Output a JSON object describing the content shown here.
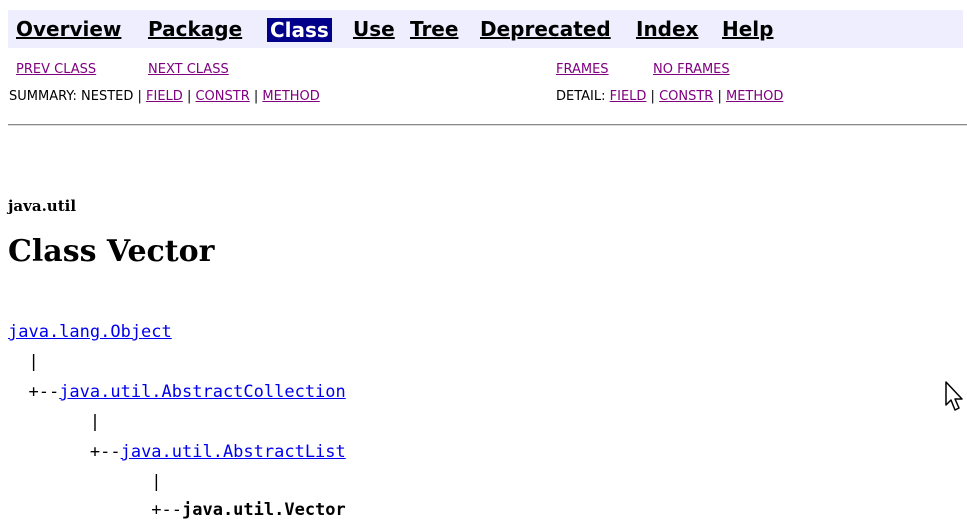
{
  "nav": {
    "overview": "Overview",
    "package": "Package",
    "class": "Class",
    "use": "Use",
    "tree": "Tree",
    "deprecated": "Deprecated",
    "index": "Index",
    "help": "Help"
  },
  "subnav": {
    "prev_class": "PREV CLASS",
    "next_class": "NEXT CLASS",
    "frames": "FRAMES",
    "no_frames": "NO FRAMES",
    "summary_prefix": "SUMMARY: NESTED | ",
    "summary_field": "FIELD",
    "sep1": " | ",
    "summary_constr": "CONSTR",
    "sep2": " | ",
    "summary_method": "METHOD",
    "detail_prefix": "DETAIL: ",
    "detail_field": "FIELD",
    "sep3": " | ",
    "detail_constr": "CONSTR",
    "sep4": " | ",
    "detail_method": "METHOD"
  },
  "header": {
    "package_name": "java.util",
    "class_title": "Class Vector"
  },
  "hierarchy": {
    "level0_link": "java.lang.Object",
    "bar1": "  |",
    "prefix1": "  +--",
    "level1_link": "java.util.AbstractCollection",
    "bar2": "        |",
    "prefix2": "        +--",
    "level2_link": "java.util.AbstractList",
    "bar3": "              |",
    "prefix3": "              +--",
    "level3_current": "java.util.Vector"
  },
  "colors": {
    "navbar_bg": "#EEEEFF",
    "active_bg": "#00008B",
    "link": "#0000EE",
    "visited_link": "#800080"
  },
  "icons": {
    "cursor": "mouse-pointer-icon"
  }
}
